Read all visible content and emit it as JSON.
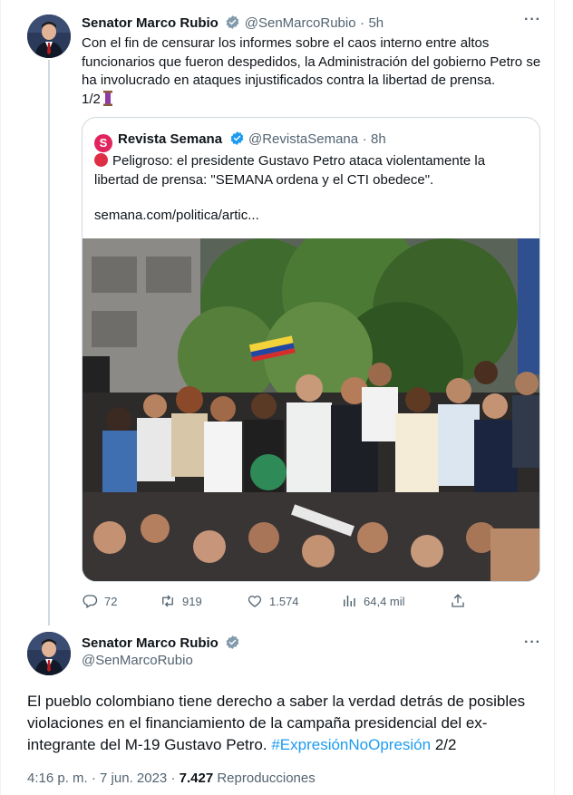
{
  "tweet1": {
    "author_name": "Senator Marco Rubio",
    "handle": "@SenMarcoRubio",
    "separator": "·",
    "time": "5h",
    "text": "Con el fin de censurar los informes sobre el caos interno entre altos funcionarios que fueron despedidos, la Administración del gobierno Petro se ha involucrado en ataques injustificados contra la libertad de prensa.",
    "thread_marker": "1/2",
    "more_label": "···"
  },
  "quote": {
    "logo_letter": "S",
    "author_name": "Revista Semana",
    "handle": "@RevistaSemana",
    "separator": "·",
    "time": "8h",
    "text": "Peligroso: el presidente Gustavo Petro ataca violentamente la libertad de prensa: \"SEMANA ordena y el CTI obedece\".",
    "link": "semana.com/politica/artic..."
  },
  "actions": {
    "replies": "72",
    "retweets": "919",
    "likes": "1.574",
    "views": "64,4 mil"
  },
  "tweet2": {
    "author_name": "Senator Marco Rubio",
    "handle": "@SenMarcoRubio",
    "text_before": "El pueblo colombiano tiene derecho a saber la verdad detrás de posibles violaciones en el financiamiento de la campaña presidencial del ex-integrante del M-19 Gustavo Petro.",
    "hashtag": "#ExpresiónNoOpresión",
    "thread_marker": "2/2",
    "time": "4:16 p. m.",
    "separator1": "·",
    "date": "7 jun. 2023",
    "separator2": "·",
    "views_count": "7.427",
    "views_label": "Reproducciones",
    "more_label": "···"
  },
  "colors": {
    "accent": "#1d9bf0",
    "secondary_text": "#536471",
    "primary_text": "#0f1419",
    "border": "#cfd9de",
    "semana_brand": "#e0245e"
  }
}
